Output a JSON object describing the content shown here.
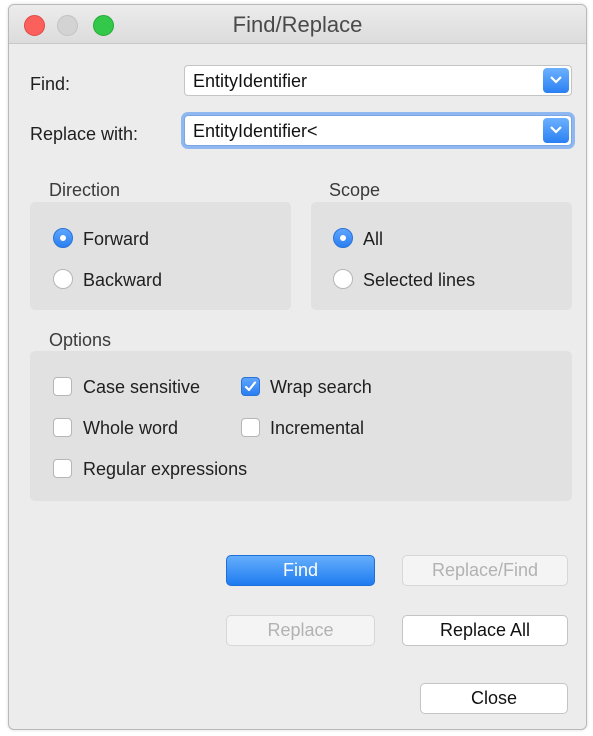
{
  "window": {
    "title": "Find/Replace"
  },
  "find": {
    "label": "Find:",
    "value": "EntityIdentifier"
  },
  "replace": {
    "label": "Replace with:",
    "value": "EntityIdentifier<"
  },
  "direction": {
    "title": "Direction",
    "options": [
      {
        "label": "Forward",
        "selected": true
      },
      {
        "label": "Backward",
        "selected": false
      }
    ]
  },
  "scope": {
    "title": "Scope",
    "options": [
      {
        "label": "All",
        "selected": true
      },
      {
        "label": "Selected lines",
        "selected": false
      }
    ]
  },
  "options": {
    "title": "Options",
    "case_sensitive": {
      "label": "Case sensitive",
      "checked": false
    },
    "wrap_search": {
      "label": "Wrap search",
      "checked": true
    },
    "whole_word": {
      "label": "Whole word",
      "checked": false
    },
    "incremental": {
      "label": "Incremental",
      "checked": false
    },
    "regex": {
      "label": "Regular expressions",
      "checked": false
    }
  },
  "buttons": {
    "find": "Find",
    "replace_find": "Replace/Find",
    "replace": "Replace",
    "replace_all": "Replace All",
    "close": "Close"
  },
  "colors": {
    "accent": "#2a7ef0",
    "close_dot": "#fc605c",
    "max_dot": "#34c84a"
  }
}
